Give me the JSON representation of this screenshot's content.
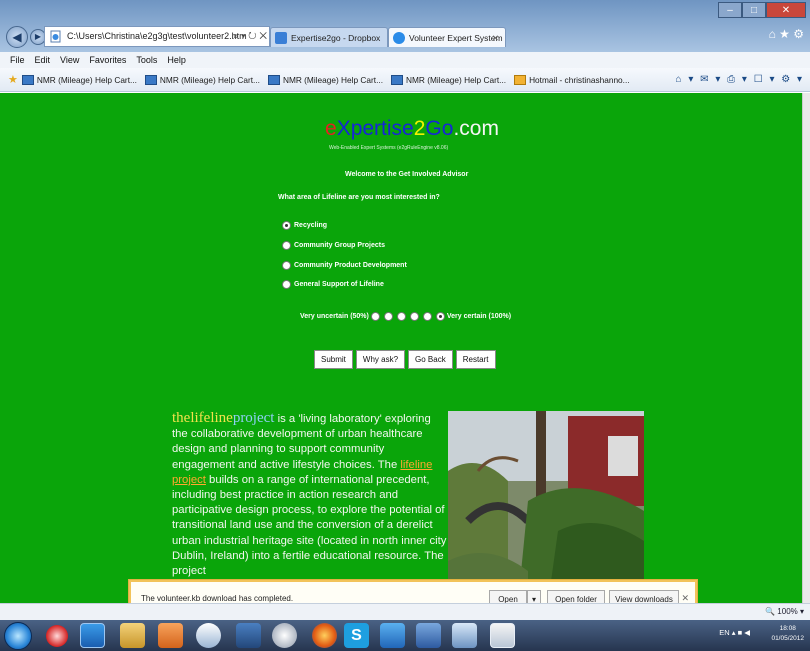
{
  "browser": {
    "address": "C:\\Users\\Christina\\e2g3g\\test\\volunteer2.htm",
    "address_tools": "⌕ ▾ ↻ ✕",
    "tabs": [
      {
        "label": "Expertise2go - Dropbox",
        "icon_color": "#3a7fd6"
      },
      {
        "label": "Volunteer Expert System",
        "icon_color": "#2a8be8",
        "close": "✕"
      }
    ],
    "window_controls": {
      "minimize": "–",
      "maximize": "□",
      "close": "✕"
    },
    "top_icons": "⌂ ★ ⚙",
    "menu": [
      "File",
      "Edit",
      "View",
      "Favorites",
      "Tools",
      "Help"
    ],
    "favorites": [
      "NMR (Mileage) Help Cart...",
      "NMR (Mileage) Help Cart...",
      "NMR (Mileage) Help Cart...",
      "NMR (Mileage) Help Cart...",
      "Hotmail - christinashanno..."
    ],
    "command_icons": "⌂ ▾ ✉ ▾ ⎙ ▾ ☐ ▾ ⚙ ▾"
  },
  "page": {
    "logo": {
      "e": "e",
      "xpertise": "Xpertise",
      "two": "2",
      "go": "Go",
      "com": ".com"
    },
    "subtitle": "Web-Enabled Expert Systems (e2gRuleEngine v8.06)",
    "welcome": "Welcome to the Get Involved Advisor",
    "question": "What area of Lifeline are you most interested in?",
    "options": [
      {
        "label": "Recycling",
        "selected": true
      },
      {
        "label": "Community Group Projects",
        "selected": false
      },
      {
        "label": "Community Product Development",
        "selected": false
      },
      {
        "label": "General Support of Lifeline",
        "selected": false
      }
    ],
    "certainty": {
      "low_label": "Very uncertain (50%)",
      "high_label": "Very certain (100%)",
      "steps": 6,
      "selected_step": 6
    },
    "buttons": {
      "submit": "Submit",
      "why": "Why ask?",
      "back": "Go Back",
      "restart": "Restart"
    },
    "project": {
      "brand_a": "thelifeline",
      "brand_b": "project",
      "text_1": " is a 'living laboratory' exploring the collaborative development of urban healthcare design and planning to support community engagement and active lifestyle choices. The ",
      "link": "lifeline project",
      "text_2": " builds on a range of international precedent, including best practice in action research and participative design process, to explore the potential of transitional land use and the conversion of a derelict urban industrial heritage site (located in north inner city Dublin, Ireland) into a fertile educational resource. The project"
    }
  },
  "download": {
    "message": "The volunteer.kb download has completed.",
    "open": "Open",
    "open_arrow": "▾",
    "open_folder": "Open folder",
    "view_downloads": "View downloads",
    "close": "✕"
  },
  "status": {
    "zoom": "🔍 100% ▾"
  },
  "taskbar": {
    "tray": "EN ▴ ■ ◀",
    "time": "18:08",
    "date": "01/05/2012"
  }
}
